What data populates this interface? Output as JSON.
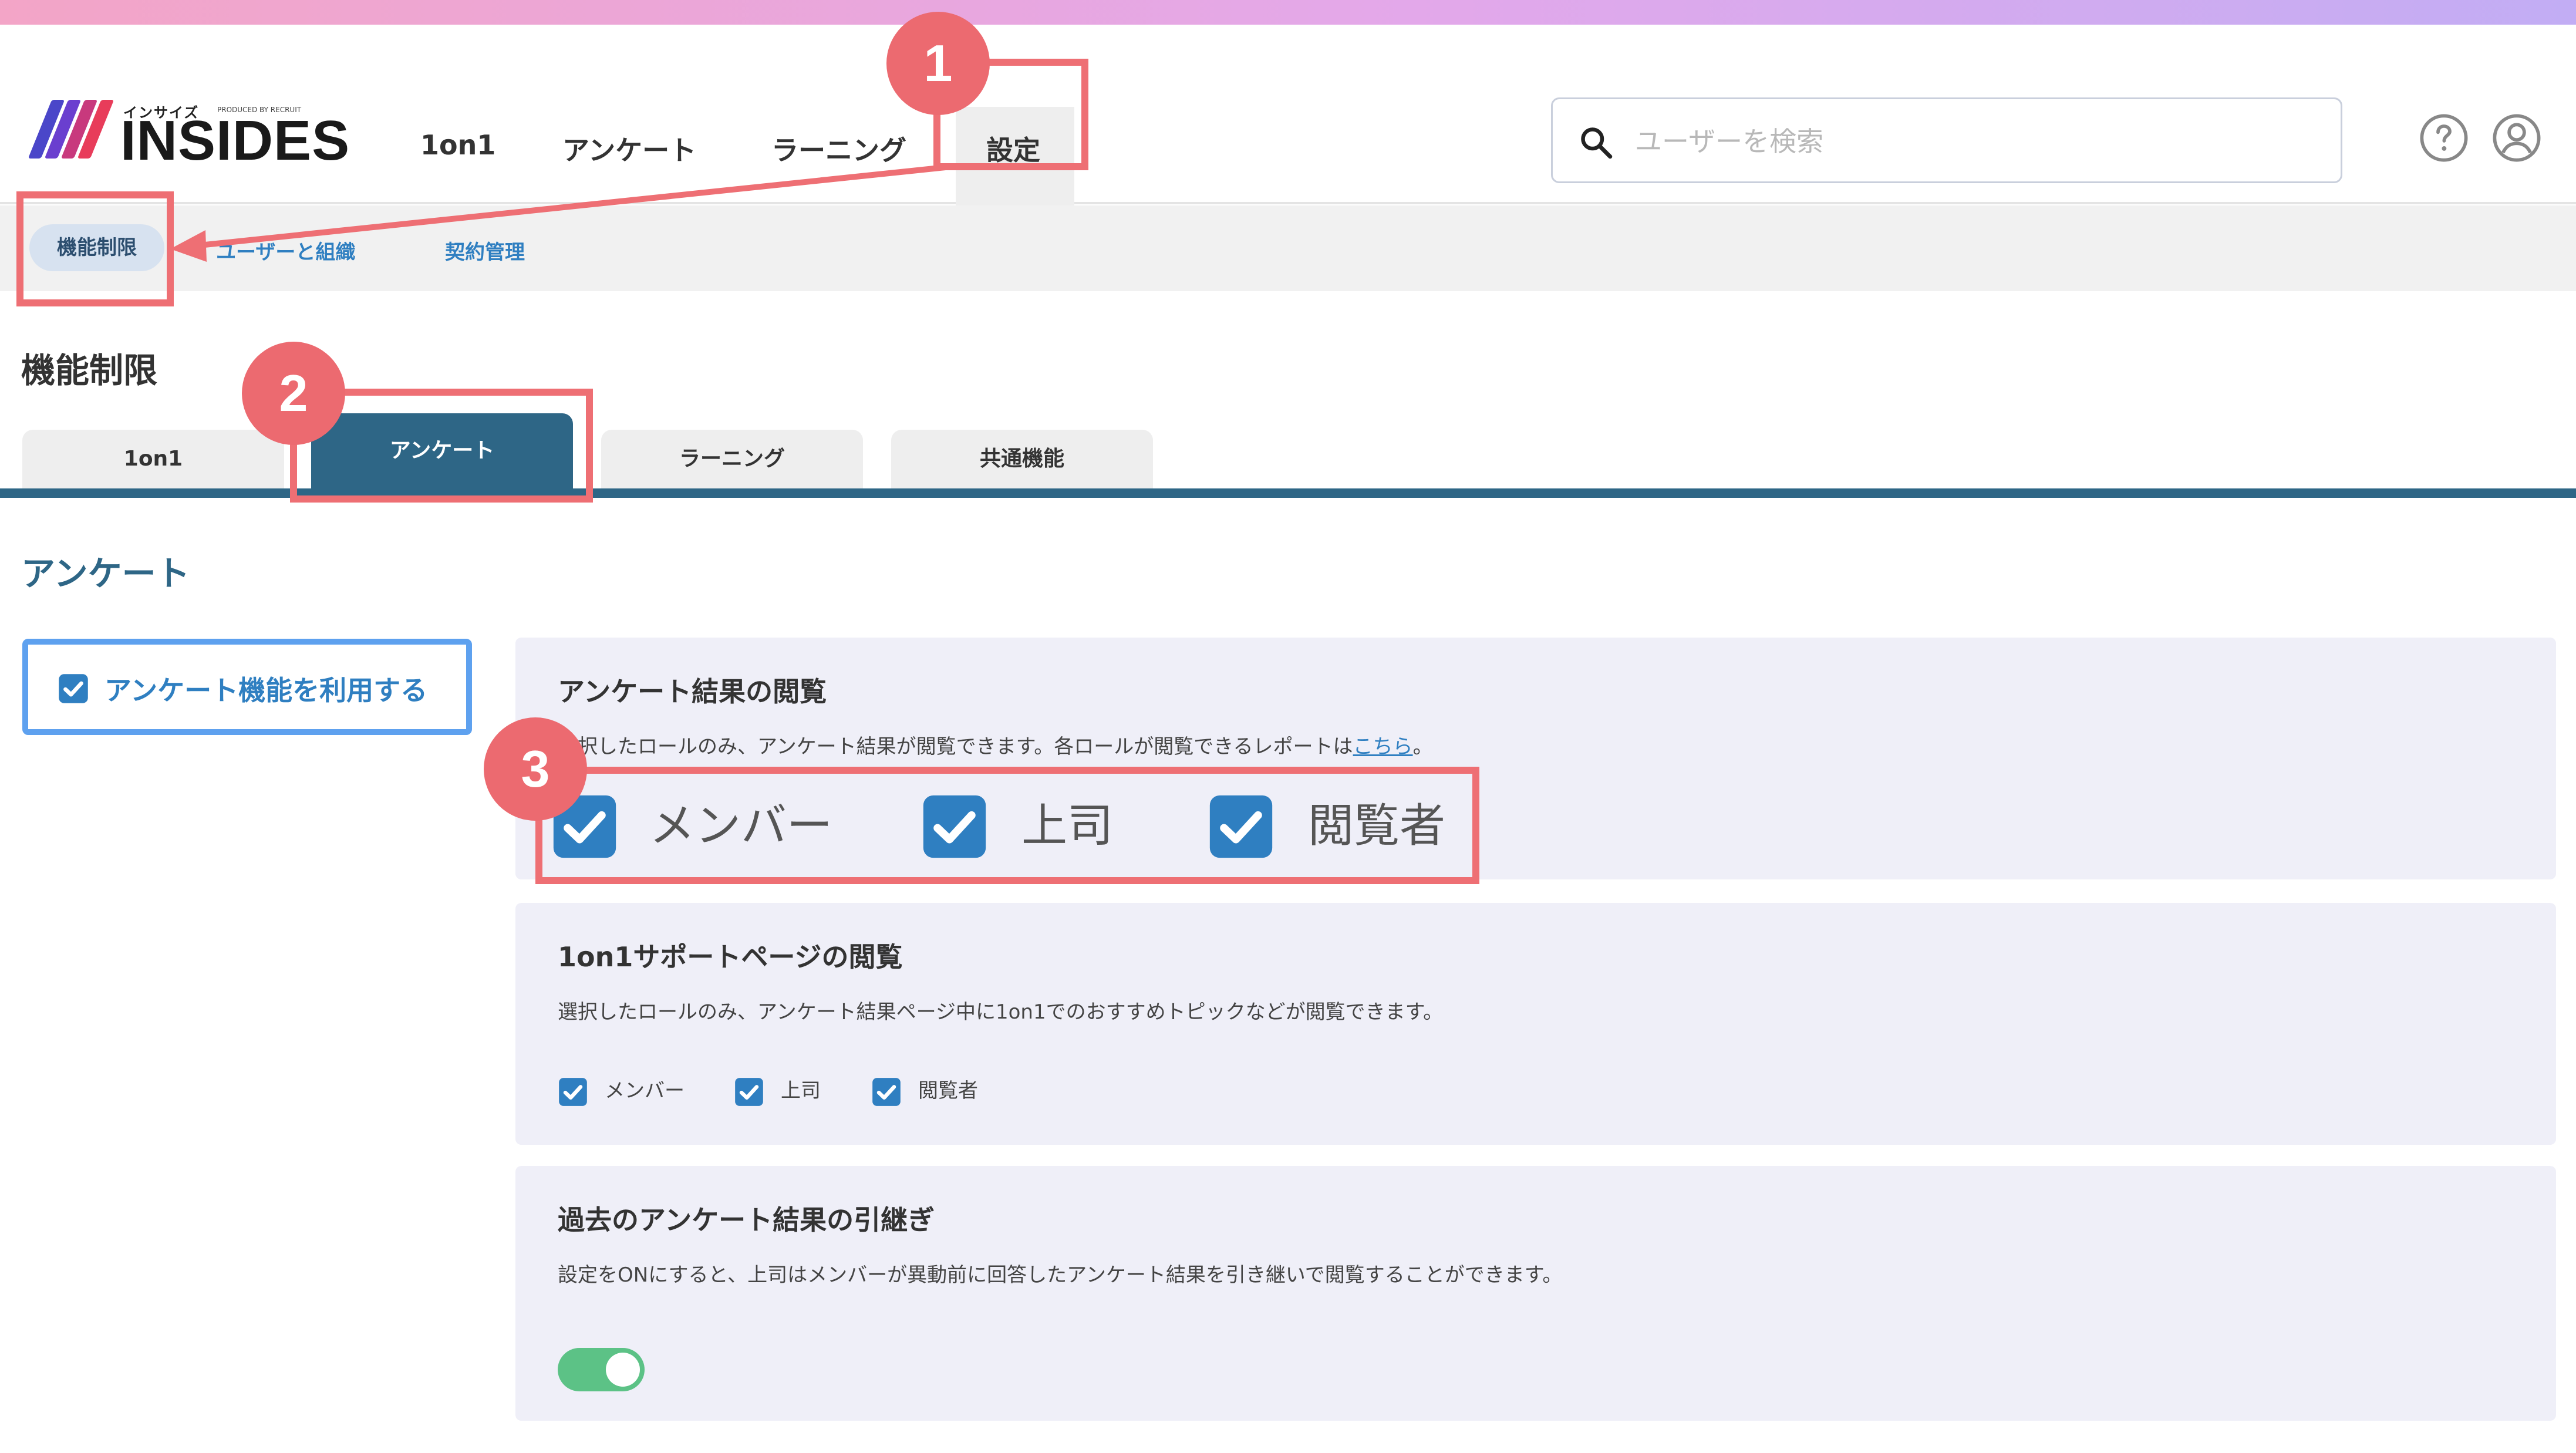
{
  "header": {
    "logo_small": "インサイズ",
    "logo_produced": "PRODUCED BY RECRUIT",
    "logo_name": "INSIDES",
    "nav": [
      "1on1",
      "アンケート",
      "ラーニング",
      "設定"
    ],
    "search_placeholder": "ユーザーを検索"
  },
  "subnav": {
    "items": [
      "機能制限",
      "ユーザーと組織",
      "契約管理"
    ]
  },
  "page_title": "機能制限",
  "tabs": [
    "1on1",
    "アンケート",
    "ラーニング",
    "共通機能"
  ],
  "section_title": "アンケート",
  "enable_toggle": {
    "label": "アンケート機能を利用する",
    "checked": true
  },
  "cards": {
    "results": {
      "title": "アンケート結果の閲覧",
      "desc_prefix": "選択したロールのみ、アンケート結果が閲覧できます。各ロールが閲覧できるレポートは",
      "desc_link": "こちら",
      "desc_suffix": "。",
      "roles": [
        "メンバー",
        "上司",
        "閲覧者"
      ]
    },
    "support": {
      "title": "1on1サポートページの閲覧",
      "desc": "選択したロールのみ、アンケート結果ページ中に1on1でのおすすめトピックなどが閲覧できます。",
      "roles": [
        "メンバー",
        "上司",
        "閲覧者"
      ]
    },
    "carryover": {
      "title": "過去のアンケート結果の引継ぎ",
      "desc": "設定をONにすると、上司はメンバーが異動前に回答したアンケート結果を引き継いで閲覧することができます。",
      "toggle_on": true
    }
  },
  "annotations": [
    "1",
    "2",
    "3"
  ],
  "colors": {
    "accent_blue": "#2f7fc1",
    "tab_active": "#2e6686",
    "annotation_red": "#ec6a70",
    "checkbox_blue": "#2f7fc1",
    "toggle_green": "#5cc286"
  }
}
